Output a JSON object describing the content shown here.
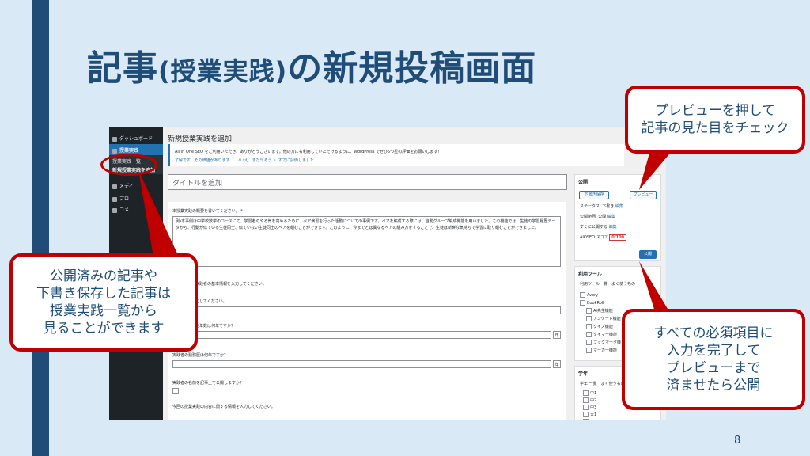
{
  "slide": {
    "title_main1": "記事",
    "title_paren": "(授業実践)",
    "title_main2": "の新規投稿画面",
    "page_number": "8"
  },
  "wp_menu": {
    "dashboard": "ダッシュボード",
    "post_type": "授業実践",
    "list": "授業実践一覧",
    "add_new": "新規授業実践を追加",
    "media": "メディ",
    "pages": "プロ",
    "comments": "コメ"
  },
  "editor": {
    "page_title": "新規授業実践を追加",
    "notice_line1": "All in One SEO をご利用いただき、ありがとうございます。他の方にも利用していただけるように、WordPress でぜひ5つ星の評価をお願いします！",
    "notice_line2": "了解です。その価値があります ・ いいえ、まだ早そう ・ すでに評価しました",
    "title_placeholder": "タイトルを追加",
    "summary_label": "本授業実践の概要を書いてください。 *",
    "summary_text": "例)本事例は中学校数学のコースにて、学習者のやる気を高めるために、ペア演習を行った活動についての事例です。ペアを編成する際には、自動グループ編成機能を用いました。この機能では、生徒の学習履歴データから、行動が似ている生徒同士、似ていない生徒同士のペアを組むことができます。このように、今までとは異なるペアの組み方をすることで、生徒は新鮮な気持ちで学習に取り組むことができました。",
    "field_basic_info": "の実践者の基本情報を入力してください。",
    "field_input": "入力してください。",
    "field_years": "担当年数は何年ですか？",
    "field_years_unit": "年",
    "field_experience": "実践者の勤務歴は何年ですか？",
    "field_experience_unit": "年",
    "field_name_public": "実践者の名前を記事上で公開しますか？",
    "field_related_info": "今回の授業実践の内容に関する情報を入力してください。"
  },
  "publish_box": {
    "heading": "公開",
    "save_draft": "下書き保存",
    "preview": "プレビュー",
    "status": "ステータス: 下書き",
    "edit1": "編集",
    "visibility": "公開範囲: 公開",
    "edit2": "編集",
    "schedule": "すぐに公開する",
    "edit3": "編集",
    "aioseo": "AIOSEO スコア",
    "score": "0/100",
    "publish": "公開"
  },
  "tools_box": {
    "heading": "利用ツール",
    "tabs": "利用ツール一覧　よく使うもの",
    "items": [
      "Avery",
      "BookRoll",
      "AI先生機能",
      "アンケート機能",
      "クイズ機能",
      "タイマー機能",
      "ブックマーク機",
      "マーカー機能"
    ]
  },
  "grade_box": {
    "heading": "学年",
    "tabs": "学年 一覧　よく使うもの",
    "items": [
      "中1",
      "中2",
      "中3",
      "大1",
      "大2",
      "大3"
    ]
  },
  "callouts": {
    "left": "公開済みの記事や\n下書き保存した記事は\n授業実践一覧から\n見ることができます",
    "top_right": "プレビューを押して\n記事の見た目をチェック",
    "bottom_right": "すべての必須項目に\n入力を完了して\nプレビューまで\n済ませたら公開"
  },
  "colors": {
    "background": "#d9e9f6",
    "accent": "#1f4d78",
    "callout_border": "#c00000",
    "wp_blue": "#2271b1"
  }
}
